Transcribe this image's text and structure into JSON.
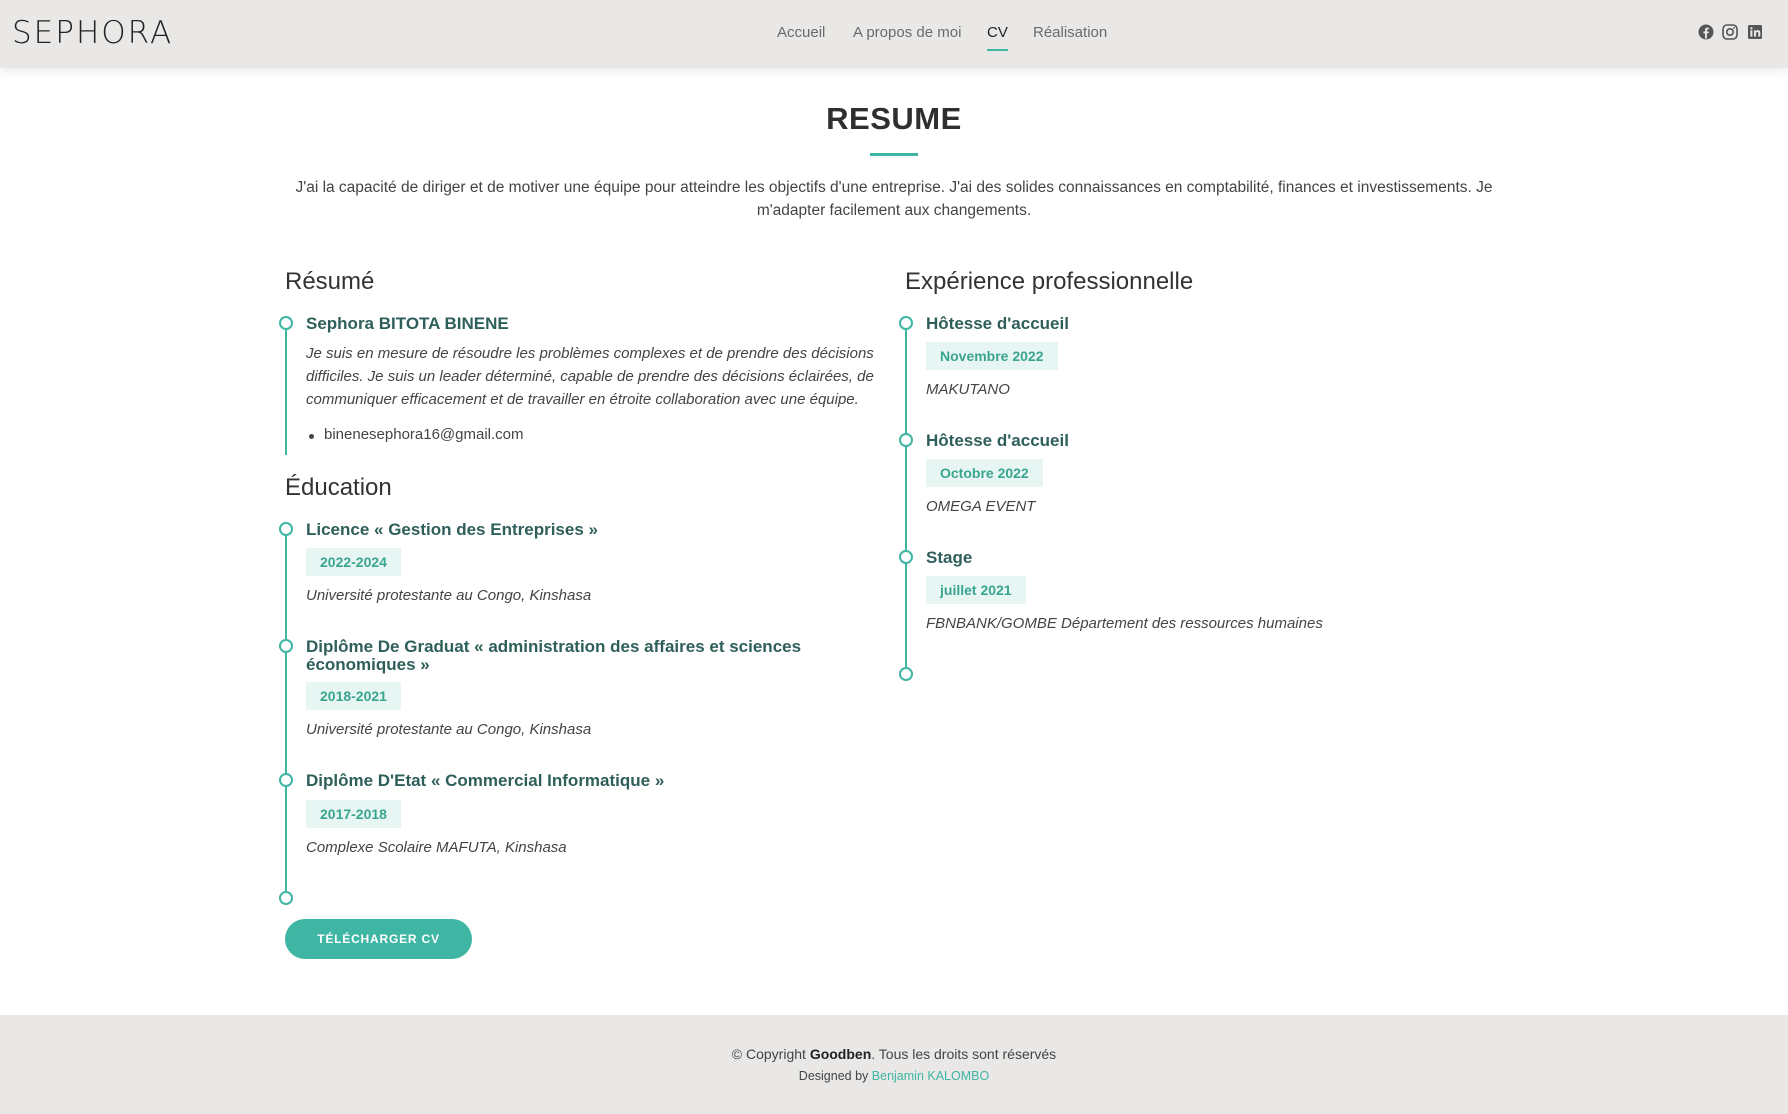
{
  "brand": "SEPHORA",
  "nav": {
    "items": [
      {
        "label": "Accueil"
      },
      {
        "label": "A propos de moi"
      },
      {
        "label": "CV",
        "active": true
      },
      {
        "label": "Réalisation"
      }
    ]
  },
  "social": {
    "icons": [
      "facebook-icon",
      "instagram-icon",
      "linkedin-icon"
    ]
  },
  "colors": {
    "accent": "#3fb5a3",
    "header_bg": "#e9e8e6",
    "title_text": "#2f5f5a",
    "badge_bg": "#e7f6f3"
  },
  "section": {
    "title": "RESUME",
    "intro": "J'ai la capacité de diriger et de motiver une équipe pour atteindre les objectifs d'une entreprise. J'ai des solides connaissances en comptabilité, finances et investissements. Je m'adapter facilement aux changements."
  },
  "resume": {
    "heading": "Résumé",
    "name": "Sephora BITOTA BINENE",
    "summary": "Je suis en mesure de résoudre les problèmes complexes et de prendre des décisions difficiles. Je suis un leader déterminé, capable de prendre des décisions éclairées, de communiquer efficacement et de travailler en étroite collaboration avec une équipe.",
    "email": "binenesephora16@gmail.com"
  },
  "education": {
    "heading": "Éducation",
    "items": [
      {
        "title": "Licence « Gestion des Entreprises »",
        "period": "2022-2024",
        "place": "Université protestante au Congo, Kinshasa"
      },
      {
        "title": "Diplôme De Graduat « administration des affaires et sciences économiques »",
        "period": "2018-2021",
        "place": "Université protestante au Congo, Kinshasa"
      },
      {
        "title": "Diplôme D'Etat « Commercial Informatique »",
        "period": "2017-2018",
        "place": "Complexe Scolaire MAFUTA, Kinshasa"
      }
    ]
  },
  "experience": {
    "heading": "Expérience professionnelle",
    "items": [
      {
        "title": "Hôtesse d'accueil",
        "period": "Novembre 2022",
        "place": "MAKUTANO"
      },
      {
        "title": "Hôtesse d'accueil",
        "period": "Octobre 2022",
        "place": "OMEGA EVENT"
      },
      {
        "title": "Stage",
        "period": "juillet 2021",
        "place": "FBNBANK/GOMBE Département des ressources humaines"
      }
    ]
  },
  "download_button": "TÉLÉCHARGER CV",
  "footer": {
    "copyright_prefix": "© Copyright",
    "company": "Goodben",
    "copyright_suffix": ". Tous les droits sont réservés",
    "designed_by": "Designed by",
    "designer": "Benjamin KALOMBO"
  }
}
